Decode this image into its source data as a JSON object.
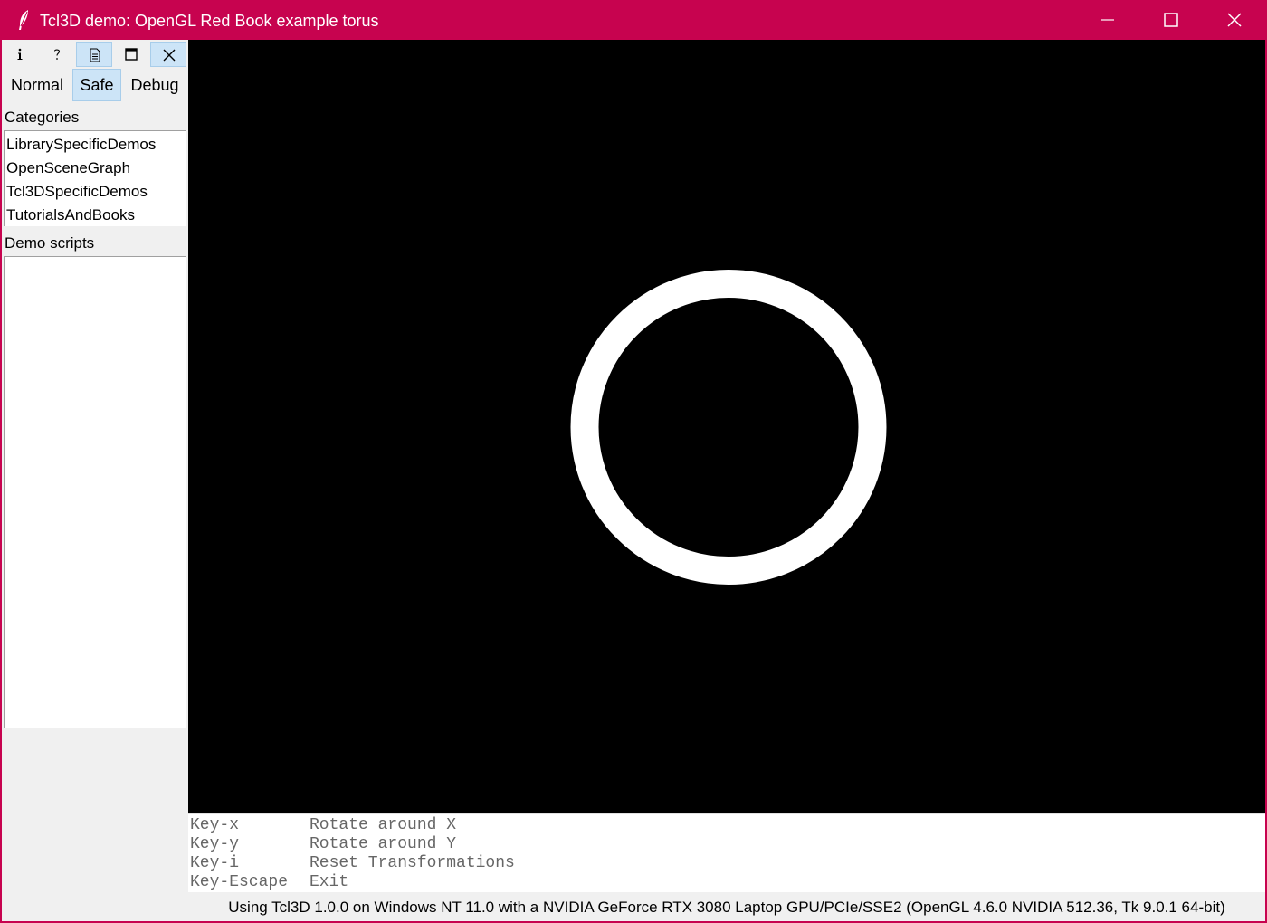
{
  "window": {
    "title": "Tcl3D demo: OpenGL Red Book example torus",
    "accent_color": "#c7034f",
    "icon": "feather-icon"
  },
  "toolbar": {
    "buttons": [
      {
        "icon": "info-icon",
        "active": false
      },
      {
        "icon": "help-icon",
        "active": false
      },
      {
        "icon": "document-icon",
        "active": true
      },
      {
        "icon": "window-icon",
        "active": false
      },
      {
        "icon": "close-icon",
        "active": true
      }
    ]
  },
  "modes": {
    "normal": "Normal",
    "safe": "Safe",
    "debug": "Debug",
    "selected": "Safe"
  },
  "sidebar": {
    "categories_label": "Categories",
    "categories": [
      "LibrarySpecificDemos",
      "OpenSceneGraph",
      "Tcl3DSpecificDemos",
      "TutorialsAndBooks"
    ],
    "demo_scripts_label": "Demo scripts",
    "demo_scripts": []
  },
  "canvas": {
    "background": "#000000",
    "shape": "torus",
    "shape_color": "#ffffff"
  },
  "keys": [
    {
      "key": "Key-x",
      "action": "Rotate around X"
    },
    {
      "key": "Key-y",
      "action": "Rotate around Y"
    },
    {
      "key": "Key-i",
      "action": "Reset Transformations"
    },
    {
      "key": "Key-Escape",
      "action": "Exit"
    }
  ],
  "status": "Using Tcl3D 1.0.0 on Windows NT 11.0 with a NVIDIA GeForce RTX 3080 Laptop GPU/PCIe/SSE2 (OpenGL 4.6.0 NVIDIA 512.36, Tk 9.0.1 64-bit)"
}
